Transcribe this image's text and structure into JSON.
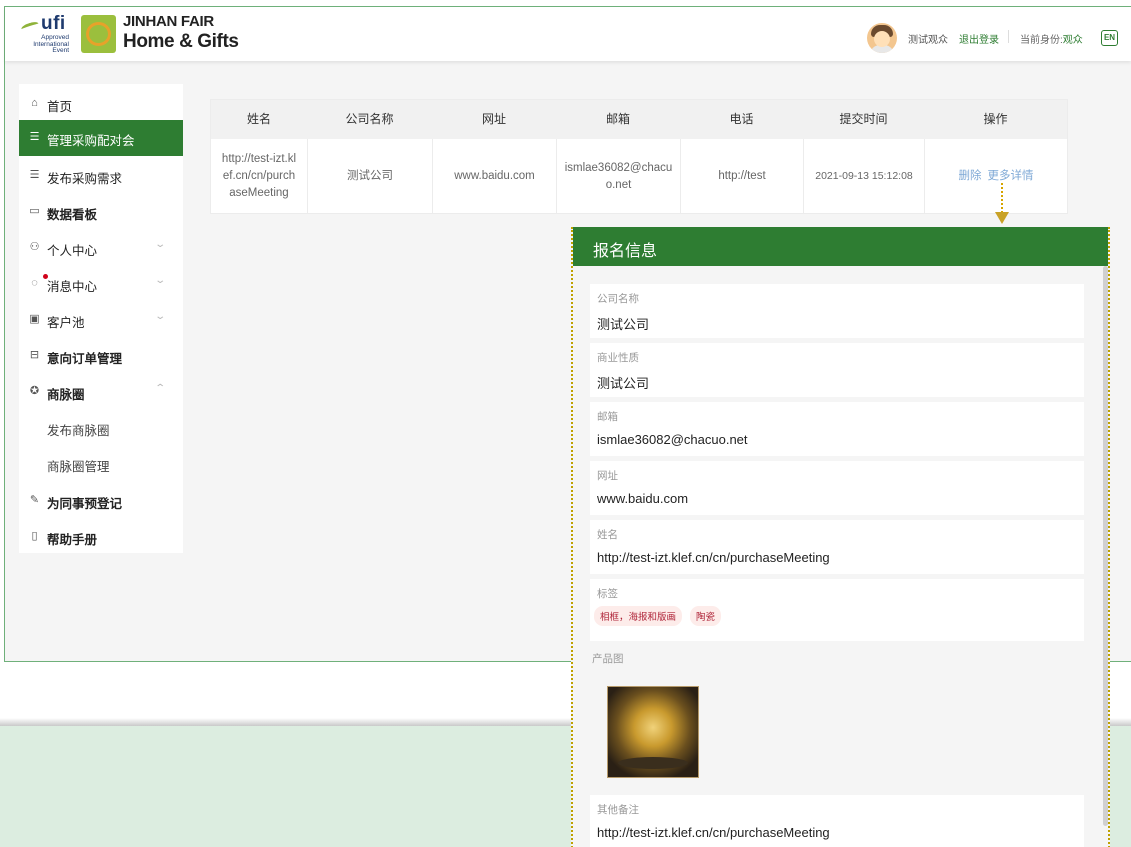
{
  "header": {
    "ufi_logo": {
      "word": "ufi",
      "sub_lines": [
        "Approved",
        "International",
        "Event"
      ]
    },
    "brand_line1": "JINHAN FAIR",
    "brand_line2": "Home & Gifts",
    "user_name": "测试观众",
    "logout": "退出登录",
    "role_label": "当前身份:",
    "role_value": "观众",
    "lang_button": "EN"
  },
  "sidebar": {
    "items": [
      {
        "label": "首页",
        "icon": "home-icon"
      },
      {
        "label": "管理采购配对会",
        "icon": "database-icon",
        "active": true
      },
      {
        "label": "发布采购需求",
        "icon": "database-icon"
      },
      {
        "label": "数据看板",
        "icon": "dashboard-icon"
      },
      {
        "label": "个人中心",
        "icon": "user-icon",
        "expandable": true
      },
      {
        "label": "消息中心",
        "icon": "message-icon",
        "expandable": true,
        "badge": true
      },
      {
        "label": "客户池",
        "icon": "inbox-icon",
        "expandable": true
      },
      {
        "label": "意向订单管理",
        "icon": "order-icon"
      },
      {
        "label": "商脉圈",
        "icon": "circle-icon",
        "expanded": true
      },
      {
        "label": "发布商脉圈",
        "sub": true
      },
      {
        "label": "商脉圈管理",
        "sub": true
      },
      {
        "label": "为同事预登记",
        "icon": "register-icon"
      },
      {
        "label": "帮助手册",
        "icon": "book-icon"
      }
    ]
  },
  "table": {
    "columns": [
      "姓名",
      "公司名称",
      "网址",
      "邮箱",
      "电话",
      "提交时间",
      "操作"
    ],
    "rows": [
      {
        "name": "http://test-izt.klef.cn/cn/purchaseMeeting",
        "name_lines": [
          "http://test-izt.kl",
          "ef.cn/cn/purch",
          "aseMeeting"
        ],
        "company": "测试公司",
        "website": "www.baidu.com",
        "email_lines": [
          "ismlae36082@chacu",
          "o.net"
        ],
        "phone": "http://test",
        "submit_time": "2021-09-13 15:12:08",
        "actions": [
          "删除",
          "更多详情"
        ]
      }
    ]
  },
  "detail_panel": {
    "title": "报名信息",
    "fields": [
      {
        "label": "公司名称",
        "value": "测试公司"
      },
      {
        "label": "商业性质",
        "value": "测试公司"
      },
      {
        "label": "邮箱",
        "value": "ismlae36082@chacuo.net"
      },
      {
        "label": "网址",
        "value": "www.baidu.com"
      },
      {
        "label": "姓名",
        "value": "http://test-izt.klef.cn/cn/purchaseMeeting"
      }
    ],
    "tags_label": "标签",
    "tags": [
      "相框，海报和版画",
      "陶瓷"
    ],
    "product_image_label": "产品图",
    "remarks_label": "其他备注",
    "remarks_value": "http://test-izt.klef.cn/cn/purchaseMeeting"
  },
  "colors": {
    "brand_green": "#2e7d32",
    "link_blue": "#7fa9d6",
    "tag_red": "#b0263a",
    "highlight_gold": "#c9a227"
  }
}
